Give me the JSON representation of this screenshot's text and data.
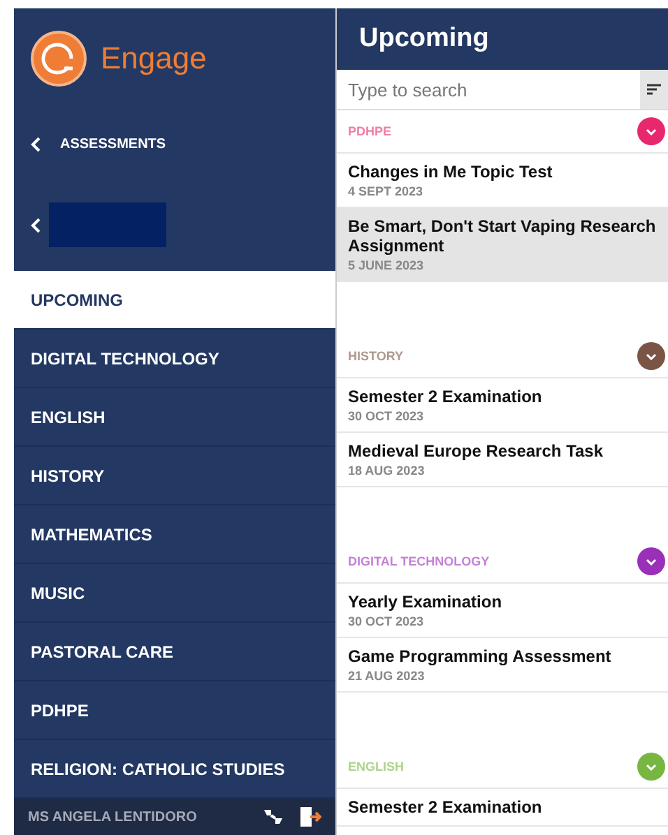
{
  "app": {
    "name": "Engage"
  },
  "sidebar": {
    "back_label": "ASSESSMENTS",
    "items": [
      {
        "label": "UPCOMING",
        "selected": true
      },
      {
        "label": "DIGITAL TECHNOLOGY",
        "selected": false
      },
      {
        "label": "ENGLISH",
        "selected": false
      },
      {
        "label": "HISTORY",
        "selected": false
      },
      {
        "label": "MATHEMATICS",
        "selected": false
      },
      {
        "label": "MUSIC",
        "selected": false
      },
      {
        "label": "PASTORAL CARE",
        "selected": false
      },
      {
        "label": "PDHPE",
        "selected": false
      },
      {
        "label": "RELIGION: CATHOLIC STUDIES",
        "selected": false
      }
    ],
    "user": "MS ANGELA LENTIDORO"
  },
  "main": {
    "title": "Upcoming",
    "search": {
      "placeholder": "Type to search"
    },
    "groups": [
      {
        "subject": "PDHPE",
        "color": "#e8286e",
        "items": [
          {
            "title": "Changes in Me Topic Test",
            "date": "4 SEPT 2023",
            "selected": false
          },
          {
            "title": "Be Smart, Don't Start Vaping Research Assignment",
            "date": "5 JUNE 2023",
            "selected": true
          }
        ]
      },
      {
        "subject": "HISTORY",
        "color": "#7a5546",
        "items": [
          {
            "title": "Semester 2 Examination",
            "date": "30 OCT 2023",
            "selected": false
          },
          {
            "title": "Medieval Europe Research Task",
            "date": "18 AUG 2023",
            "selected": false
          }
        ]
      },
      {
        "subject": "DIGITAL TECHNOLOGY",
        "color": "#9a2fb8",
        "items": [
          {
            "title": "Yearly Examination",
            "date": "30 OCT 2023",
            "selected": false
          },
          {
            "title": "Game Programming Assessment",
            "date": "21 AUG 2023",
            "selected": false
          }
        ]
      },
      {
        "subject": "ENGLISH",
        "color": "#78b642",
        "items": [
          {
            "title": "Semester 2 Examination",
            "selected": false
          }
        ]
      }
    ]
  }
}
